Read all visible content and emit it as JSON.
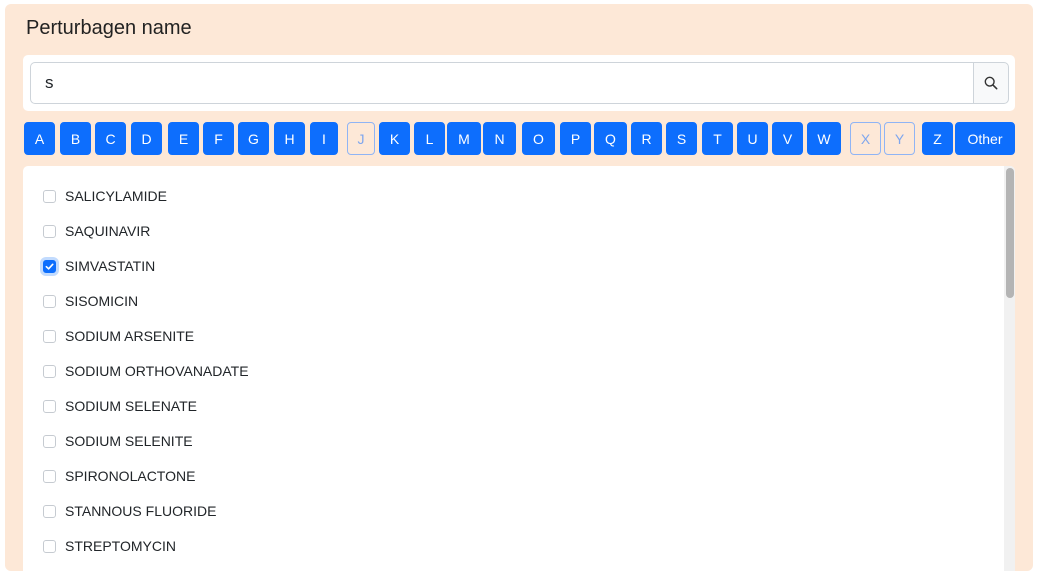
{
  "panel": {
    "title": "Perturbagen name"
  },
  "search": {
    "value": "s",
    "button_icon": "search-icon"
  },
  "letters": [
    {
      "label": "A",
      "disabled": false
    },
    {
      "label": "B",
      "disabled": false
    },
    {
      "label": "C",
      "disabled": false
    },
    {
      "label": "D",
      "disabled": false
    },
    {
      "label": "E",
      "disabled": false
    },
    {
      "label": "F",
      "disabled": false
    },
    {
      "label": "G",
      "disabled": false
    },
    {
      "label": "H",
      "disabled": false
    },
    {
      "label": "I",
      "disabled": false
    },
    {
      "label": "J",
      "disabled": true
    },
    {
      "label": "K",
      "disabled": false
    },
    {
      "label": "L",
      "disabled": false
    },
    {
      "label": "M",
      "disabled": false
    },
    {
      "label": "N",
      "disabled": false
    },
    {
      "label": "O",
      "disabled": false
    },
    {
      "label": "P",
      "disabled": false
    },
    {
      "label": "Q",
      "disabled": false
    },
    {
      "label": "R",
      "disabled": false
    },
    {
      "label": "S",
      "disabled": false
    },
    {
      "label": "T",
      "disabled": false
    },
    {
      "label": "U",
      "disabled": false
    },
    {
      "label": "V",
      "disabled": false
    },
    {
      "label": "W",
      "disabled": false
    },
    {
      "label": "X",
      "disabled": true
    },
    {
      "label": "Y",
      "disabled": true
    },
    {
      "label": "Z",
      "disabled": false
    },
    {
      "label": "Other",
      "disabled": false
    }
  ],
  "items": [
    {
      "label": "SALICYLAMIDE",
      "checked": false
    },
    {
      "label": "SAQUINAVIR",
      "checked": false
    },
    {
      "label": "SIMVASTATIN",
      "checked": true
    },
    {
      "label": "SISOMICIN",
      "checked": false
    },
    {
      "label": "SODIUM ARSENITE",
      "checked": false
    },
    {
      "label": "SODIUM ORTHOVANADATE",
      "checked": false
    },
    {
      "label": "SODIUM SELENATE",
      "checked": false
    },
    {
      "label": "SODIUM SELENITE",
      "checked": false
    },
    {
      "label": "SPIRONOLACTONE",
      "checked": false
    },
    {
      "label": "STANNOUS FLUORIDE",
      "checked": false
    },
    {
      "label": "STREPTOMYCIN",
      "checked": false
    }
  ],
  "colors": {
    "panel_bg": "#fde8d7",
    "accent": "#0d6efd",
    "disabled_text": "#7ea6ee"
  }
}
